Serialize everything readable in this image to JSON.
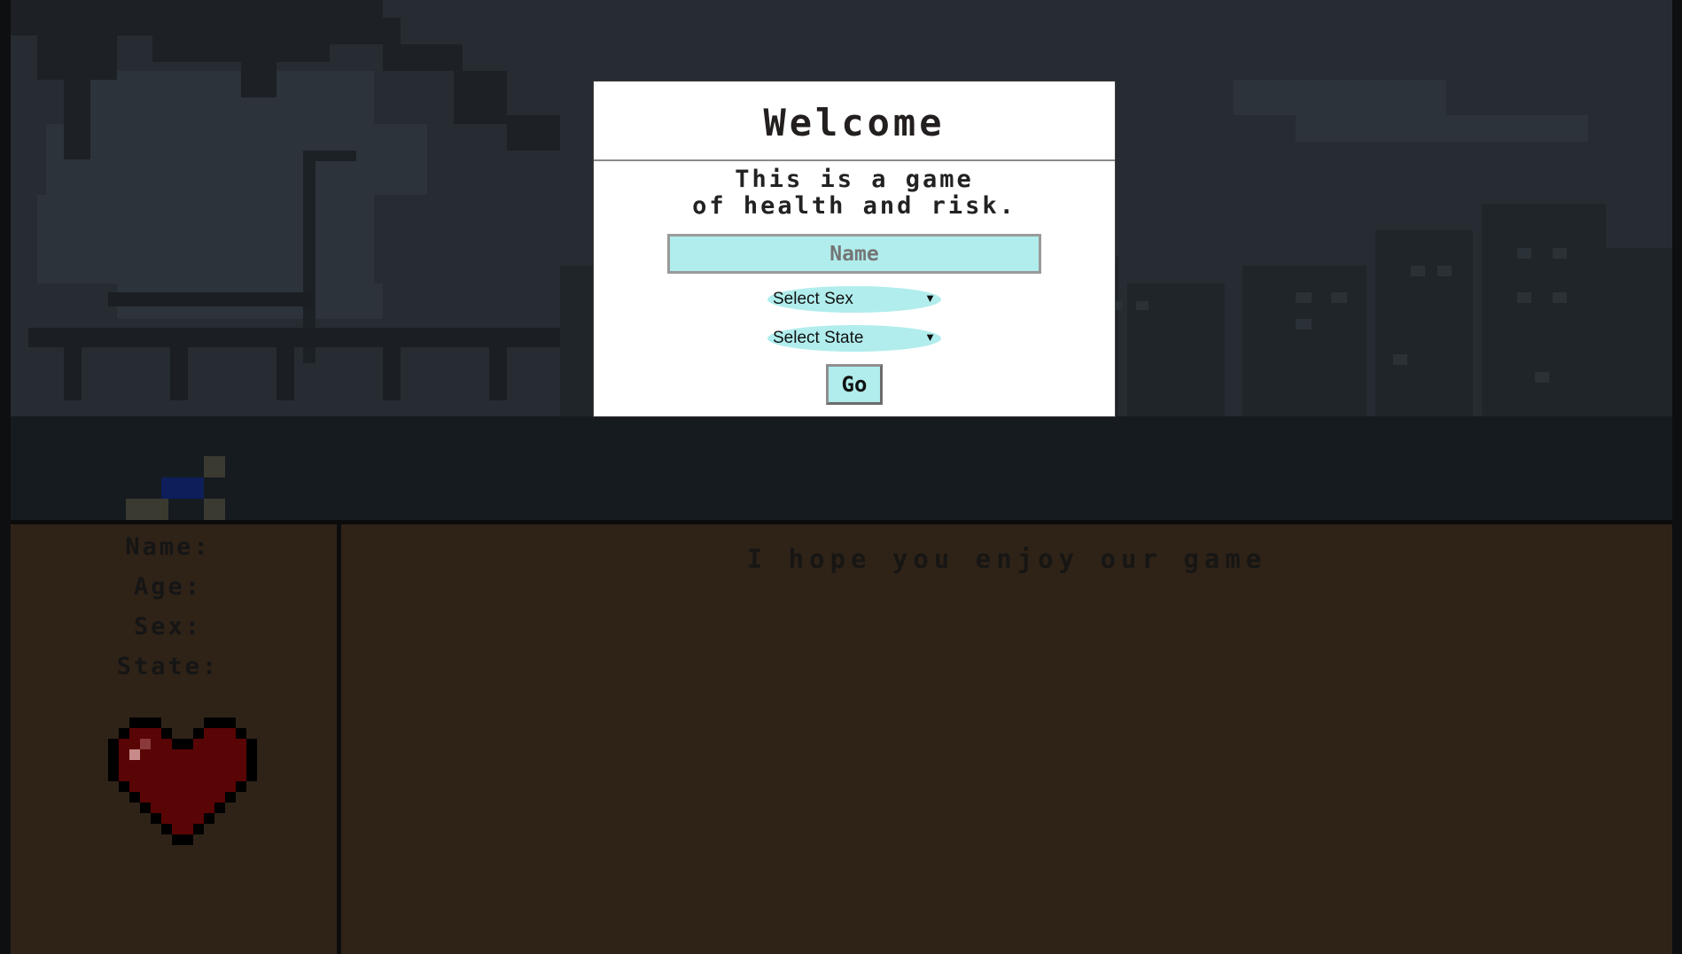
{
  "modal": {
    "title": "Welcome",
    "intro_line1": "This is a game",
    "intro_line2": "of health and risk.",
    "name_placeholder": "Name",
    "sex_select": "Select Sex",
    "state_select": "Select State",
    "go_label": "Go"
  },
  "stats": {
    "name_label": "Name:",
    "age_label": "Age:",
    "sex_label": "Sex:",
    "state_label": "State:"
  },
  "log": {
    "message": "I hope you enjoy our game"
  },
  "colors": {
    "field_bg": "#b1eded",
    "hud_bg": "#2f2318",
    "heart": "#5a0505"
  }
}
